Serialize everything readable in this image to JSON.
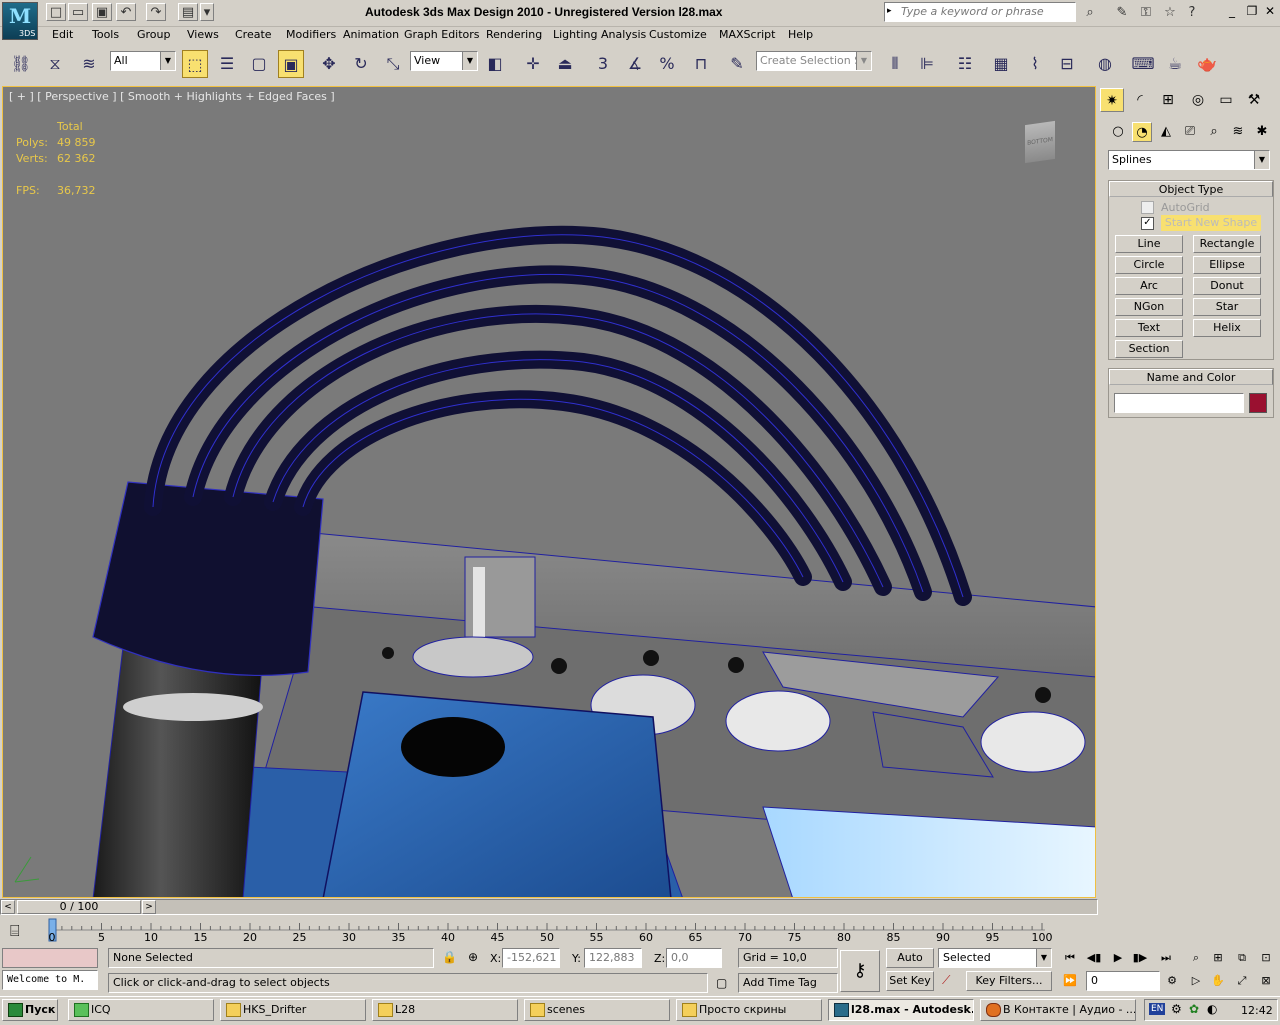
{
  "app": {
    "logo_text": "3DS",
    "title": "Autodesk 3ds Max Design 2010  -  Unregistered Version      l28.max"
  },
  "search": {
    "placeholder": "Type a keyword or phrase"
  },
  "menu": [
    "Edit",
    "Tools",
    "Group",
    "Views",
    "Create",
    "Modifiers",
    "Animation",
    "Graph Editors",
    "Rendering",
    "Lighting Analysis",
    "Customize",
    "MAXScript",
    "Help"
  ],
  "toolbar": {
    "filter_value": "All",
    "ref_coord_value": "View",
    "selection_set_placeholder": "Create Selection Se",
    "snap_label": "3"
  },
  "viewport": {
    "label": "[ + ] [ Perspective ] [ Smooth + Highlights + Edged Faces ]",
    "stats": {
      "total_label": "Total",
      "polys_label": "Polys:",
      "polys_value": "49 859",
      "verts_label": "Verts:",
      "verts_value": "62 362",
      "fps_label": "FPS:",
      "fps_value": "36,732"
    },
    "viewcube_label": "BOTTOM"
  },
  "command_panel": {
    "category_value": "Splines",
    "object_type": {
      "title": "Object Type",
      "autogrid_label": "AutoGrid",
      "start_new_shape_label": "Start New Shape",
      "buttons": [
        "Line",
        "Rectangle",
        "Circle",
        "Ellipse",
        "Arc",
        "Donut",
        "NGon",
        "Star",
        "Text",
        "Helix",
        "Section"
      ]
    },
    "name_color": {
      "title": "Name and Color",
      "name_value": "",
      "color": "#9a1030"
    }
  },
  "timeline": {
    "frame_label": "0 / 100",
    "ticks": [
      "0",
      "5",
      "10",
      "15",
      "20",
      "25",
      "30",
      "35",
      "40",
      "45",
      "50",
      "55",
      "60",
      "65",
      "70",
      "75",
      "80",
      "85",
      "90",
      "95",
      "100"
    ]
  },
  "status": {
    "selection": "None Selected",
    "prompt": "Click or click-and-drag to select objects",
    "listener": "Welcome to M.",
    "x_label": "X:",
    "x_value": "-152,621",
    "y_label": "Y:",
    "y_value": "122,883",
    "z_label": "Z:",
    "z_value": "0,0",
    "grid": "Grid = 10,0",
    "add_time_tag": "Add Time Tag",
    "auto_key": "Auto Key",
    "set_key": "Set Key",
    "key_mode_value": "Selected",
    "key_filters": "Key Filters...",
    "current_frame": "0"
  },
  "taskbar": {
    "start_label": "Пуск",
    "tasks": [
      "ICQ",
      "HKS_Drifter",
      "L28",
      "scenes",
      "Просто скрины",
      "l28.max - Autodesk...",
      "В Контакте | Аудио - ..."
    ],
    "lang": "EN",
    "clock": "12:42"
  },
  "colors": {
    "viewport_bg": "#7a7a7a",
    "wire": "#1a1aa0",
    "stats": "#e8c84a",
    "accent": "#f8e070"
  }
}
